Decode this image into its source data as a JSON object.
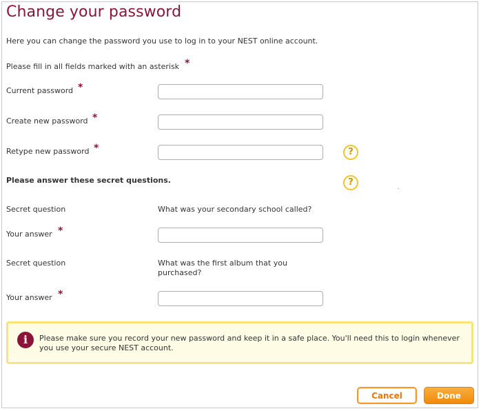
{
  "page": {
    "title": "Change your password",
    "intro": "Here you can change the password you use to log in to your NEST online account.",
    "required_note": "Please fill in all fields marked with an asterisk",
    "required_mark": "*"
  },
  "fields": {
    "current_password": {
      "label": "Current password",
      "value": ""
    },
    "new_password": {
      "label": "Create new password",
      "value": ""
    },
    "retype_password": {
      "label": "Retype new password",
      "value": ""
    }
  },
  "help_icon": {
    "icon": "question-mark-icon",
    "glyph": "?"
  },
  "secret": {
    "heading": "Please answer these secret questions.",
    "q1_label": "Secret question",
    "q1_text": "What was your secondary school called?",
    "a1_label": "Your answer",
    "a1_value": "",
    "q2_label": "Secret question",
    "q2_text_line1": "What was the first album that you",
    "q2_text_line2": "purchased?",
    "a2_label": "Your answer",
    "a2_value": ""
  },
  "notice": {
    "icon": "info-icon",
    "glyph": "i",
    "text": "Please make sure you record your new password and keep it in a safe place. You'll need this to login whenever you use your secure NEST account."
  },
  "buttons": {
    "cancel": "Cancel",
    "done": "Done"
  },
  "colors": {
    "brand": "#8a1538",
    "accent_orange": "#f08a0b",
    "help_yellow": "#f1c232",
    "notice_bg": "#fefce5",
    "notice_border": "#f5e57a"
  }
}
